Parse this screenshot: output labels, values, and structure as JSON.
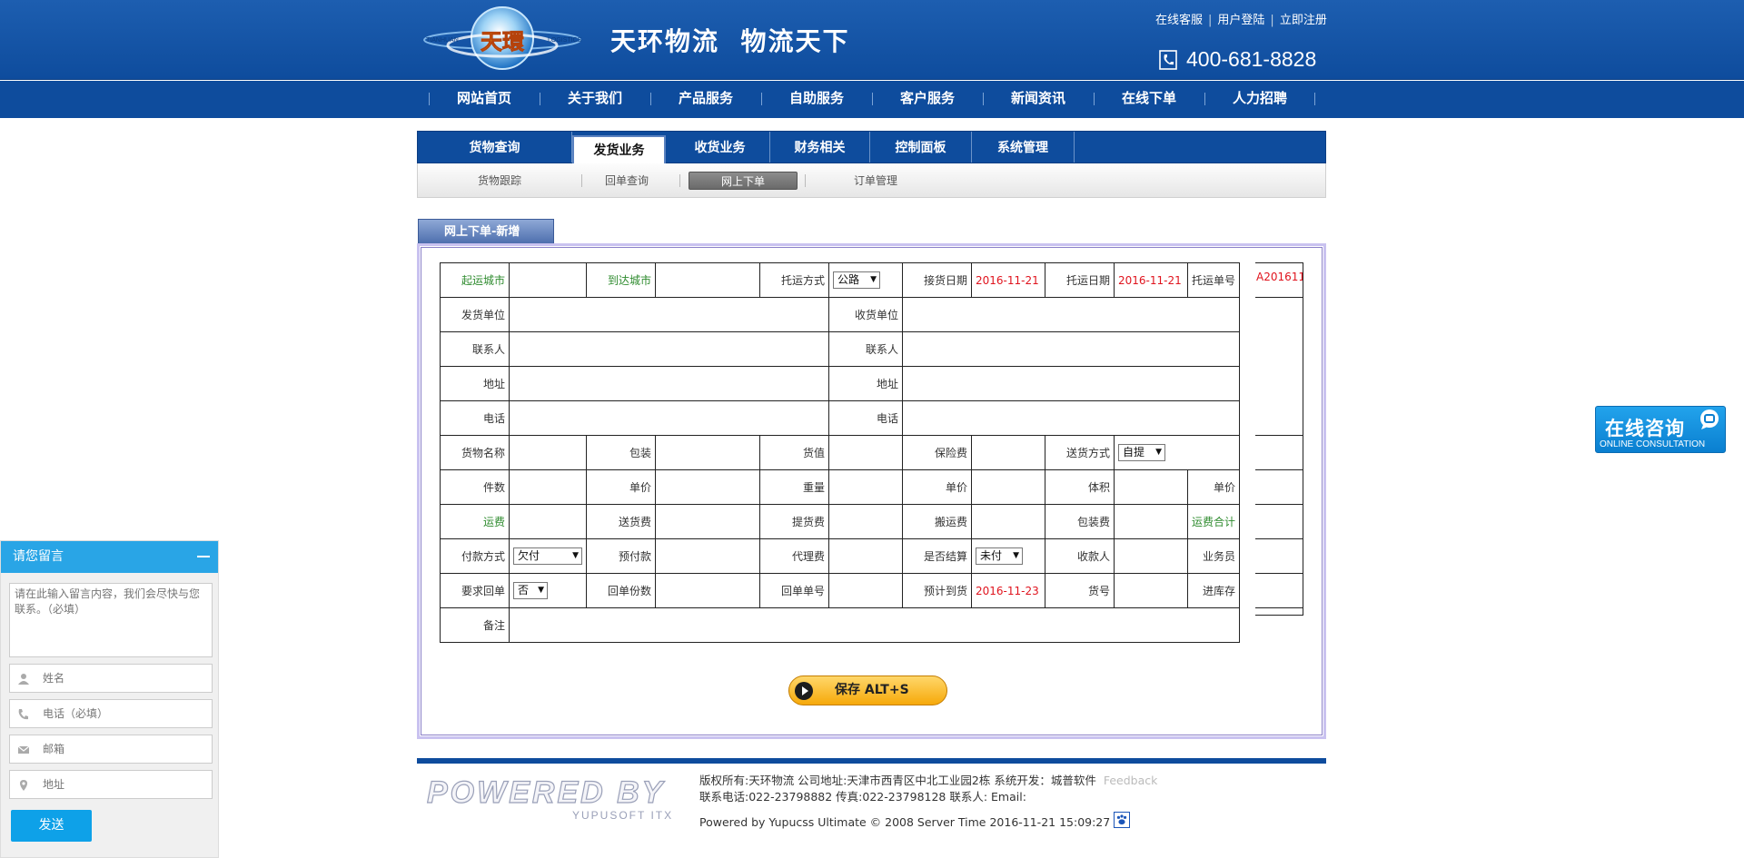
{
  "header": {
    "logo_text": "天環",
    "logo_ring_left": "TIANHUAN",
    "logo_ring_right": "LOGISTICS",
    "slogan": "天环物流  物流天下",
    "top_links": [
      "在线客服",
      "用户登陆",
      "立即注册"
    ],
    "phone": "400-681-8828"
  },
  "main_nav": [
    "网站首页",
    "关于我们",
    "产品服务",
    "自助服务",
    "客户服务",
    "新闻资讯",
    "在线下单",
    "人力招聘"
  ],
  "module_tabs": [
    "货物查询",
    "发货业务",
    "收货业务",
    "财务相关",
    "控制面板",
    "系统管理"
  ],
  "module_tab_active": "发货业务",
  "sub_tabs": [
    "货物跟踪",
    "回单查询",
    "网上下单",
    "订单管理"
  ],
  "sub_tab_active": "网上下单",
  "panel_title": "网上下单-新增",
  "form": {
    "start_city_label": "起运城市",
    "dest_city_label": "到达城市",
    "transport_label": "托运方式",
    "transport_value": "公路",
    "pickup_date_label": "接货日期",
    "pickup_date": "2016-11-21",
    "consign_date_label": "托运日期",
    "consign_date": "2016-11-21",
    "waybill_label": "托运单号",
    "waybill_no": "A201611",
    "sender_unit_label": "发货单位",
    "receiver_unit_label": "收货单位",
    "contact_label": "联系人",
    "address_label": "地址",
    "phone_label": "电话",
    "goods_name_label": "货物名称",
    "packing_label": "包装",
    "goods_value_label": "货值",
    "insurance_label": "保险费",
    "delivery_method_label": "送货方式",
    "delivery_method_value": "自提",
    "pieces_label": "件数",
    "unit_price_label": "单价",
    "weight_label": "重量",
    "volume_label": "体积",
    "freight_label": "运费",
    "delivery_fee_label": "送货费",
    "pickup_fee_label": "提货费",
    "handling_fee_label": "搬运费",
    "packing_fee_label": "包装费",
    "freight_total_label": "运费合计",
    "payment_label": "付款方式",
    "payment_value": "欠付",
    "prepaid_label": "预付款",
    "agent_fee_label": "代理费",
    "settled_label": "是否结算",
    "settled_value": "未付",
    "payee_label": "收款人",
    "salesman_label": "业务员",
    "receipt_required_label": "要求回单",
    "receipt_required_value": "否",
    "receipt_copies_label": "回单份数",
    "receipt_no_label": "回单单号",
    "eta_label": "预计到货",
    "eta": "2016-11-23",
    "cargo_no_label": "货号",
    "storage_label": "进库存",
    "remark_label": "备注"
  },
  "save_button": "保存  ALT+S",
  "footer": {
    "powered_logo": "POWERED BY",
    "powered_sub": "YUPUSOFT ITX",
    "line1": "版权所有:天环物流  公司地址:天津市西青区中北工业园2栋  系统开发：城普软件",
    "feedback": "Feedback",
    "line2": "联系电话:022-23798882  传真:022-23798128  联系人:  Email:",
    "line3": "Powered by Yupucss Ultimate © 2008  Server Time 2016-11-21 15:09:27"
  },
  "consult": {
    "title": "在线咨询",
    "subtitle": "ONLINE CONSULTATION"
  },
  "message_widget": {
    "title": "请您留言",
    "textarea_placeholder": "请在此输入留言内容，我们会尽快与您联系。（必填）",
    "name_placeholder": "姓名",
    "phone_placeholder": "电话（必填）",
    "email_placeholder": "邮箱",
    "address_placeholder": "地址",
    "send_label": "发送"
  },
  "colors": {
    "brand_blue": "#0e4c9d",
    "label_green": "#2e8b2e",
    "date_red": "#e0141e",
    "widget_blue": "#29a5e6"
  }
}
